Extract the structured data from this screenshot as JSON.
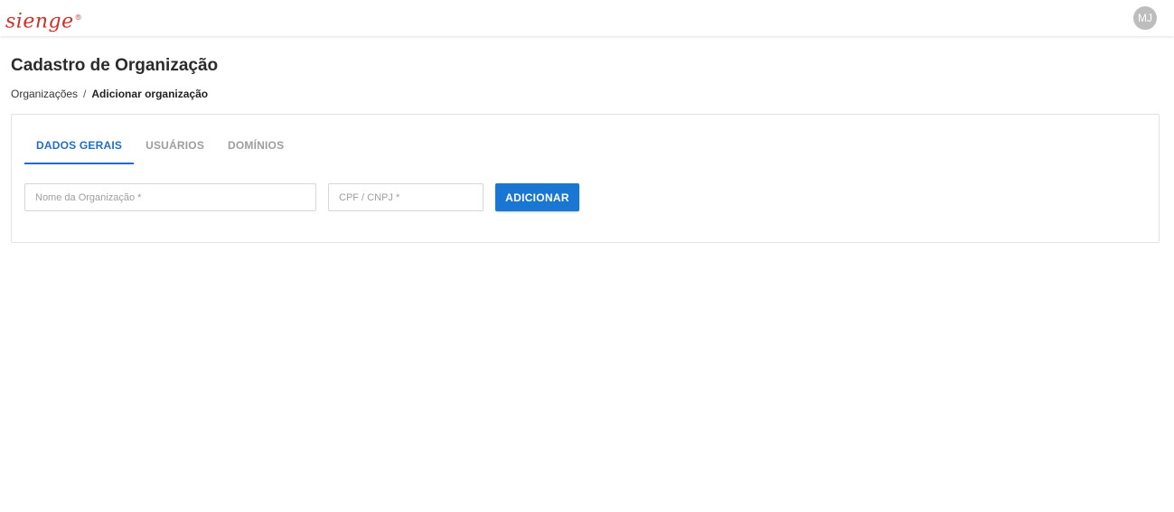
{
  "header": {
    "logo_text": "sienge",
    "logo_mark": "®",
    "avatar_initials": "MJ"
  },
  "page": {
    "title": "Cadastro de Organização"
  },
  "breadcrumb": {
    "parent": "Organizações",
    "separator": "/",
    "current": "Adicionar organização"
  },
  "tabs": [
    {
      "label": "DADOS GERAIS",
      "active": true
    },
    {
      "label": "USUÁRIOS",
      "active": false
    },
    {
      "label": "DOMÍNIOS",
      "active": false
    }
  ],
  "form": {
    "organization_name": {
      "value": "",
      "placeholder": "Nome da Organização *"
    },
    "document": {
      "value": "",
      "placeholder": "CPF / CNPJ *"
    },
    "submit_label": "ADICIONAR"
  },
  "colors": {
    "brand": "#d0302a",
    "accent": "#1976d2",
    "tab_inactive": "#9e9e9e"
  }
}
